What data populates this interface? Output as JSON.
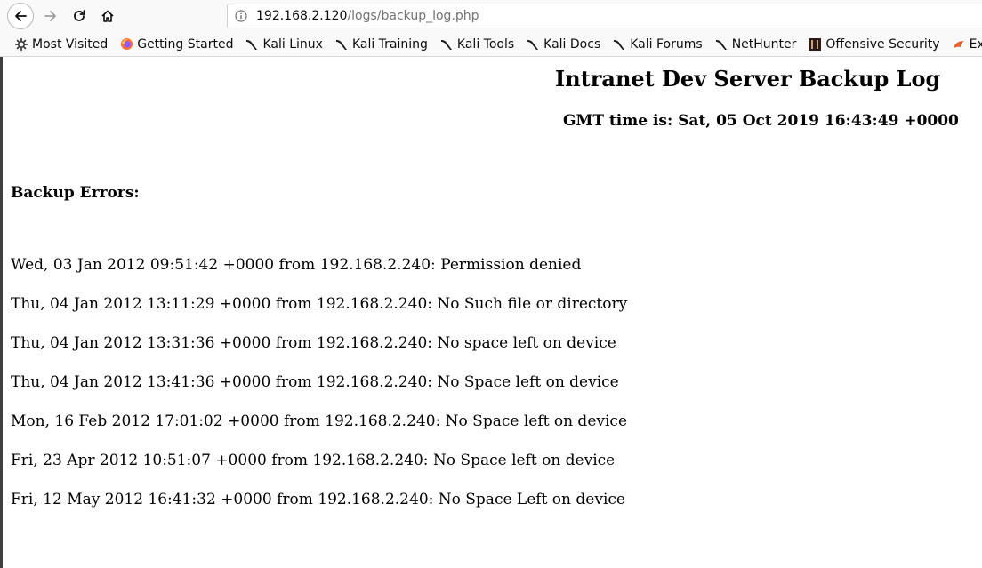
{
  "browser": {
    "url_host": "192.168.2.120",
    "url_path": "/logs/backup_log.php",
    "bookmarks": [
      {
        "label": "Most Visited",
        "icon": "gear-icon"
      },
      {
        "label": "Getting Started",
        "icon": "firefox-icon"
      },
      {
        "label": "Kali Linux",
        "icon": "kali-dragon-icon"
      },
      {
        "label": "Kali Training",
        "icon": "kali-dragon-icon"
      },
      {
        "label": "Kali Tools",
        "icon": "kali-dragon-icon"
      },
      {
        "label": "Kali Docs",
        "icon": "kali-dragon-icon"
      },
      {
        "label": "Kali Forums",
        "icon": "kali-dragon-icon"
      },
      {
        "label": "NetHunter",
        "icon": "kali-dragon-icon"
      },
      {
        "label": "Offensive Security",
        "icon": "offsec-icon"
      },
      {
        "label": "Exploit-D",
        "icon": "exploit-db-icon"
      }
    ]
  },
  "page": {
    "title": "Intranet Dev Server Backup Log",
    "gmt_line": "GMT time is: Sat, 05 Oct 2019 16:43:49 +0000",
    "errors_heading": "Backup Errors:",
    "entries": [
      "Wed, 03 Jan 2012 09:51:42 +0000 from 192.168.2.240: Permission denied",
      "Thu, 04 Jan 2012 13:11:29 +0000 from 192.168.2.240: No Such file or directory",
      "Thu, 04 Jan 2012 13:31:36 +0000 from 192.168.2.240: No space left on device",
      "Thu, 04 Jan 2012 13:41:36 +0000 from 192.168.2.240: No Space left on device",
      "Mon, 16 Feb 2012 17:01:02 +0000 from 192.168.2.240: No Space left on device",
      "Fri, 23 Apr 2012 10:51:07 +0000 from 192.168.2.240: No Space left on device",
      "Fri, 12 May 2012 16:41:32 +0000 from 192.168.2.240: No Space Left on device"
    ]
  }
}
